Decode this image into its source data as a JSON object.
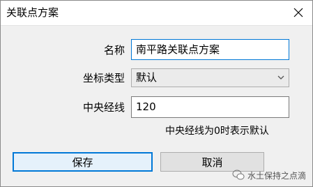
{
  "window": {
    "title": "关联点方案"
  },
  "form": {
    "name_label": "名称",
    "name_value": "南平路关联点方案",
    "type_label": "坐标类型",
    "type_value": "默认",
    "meridian_label": "中央经线",
    "meridian_value": "120",
    "hint": "中央经线为0时表示默认"
  },
  "buttons": {
    "save": "保存",
    "cancel": "取消"
  },
  "watermark": {
    "text": "水土保持之点滴"
  },
  "colors": {
    "accent": "#0078d7",
    "button_bg": "#e1e1e1",
    "dialog_bg": "#f0f0f0"
  }
}
